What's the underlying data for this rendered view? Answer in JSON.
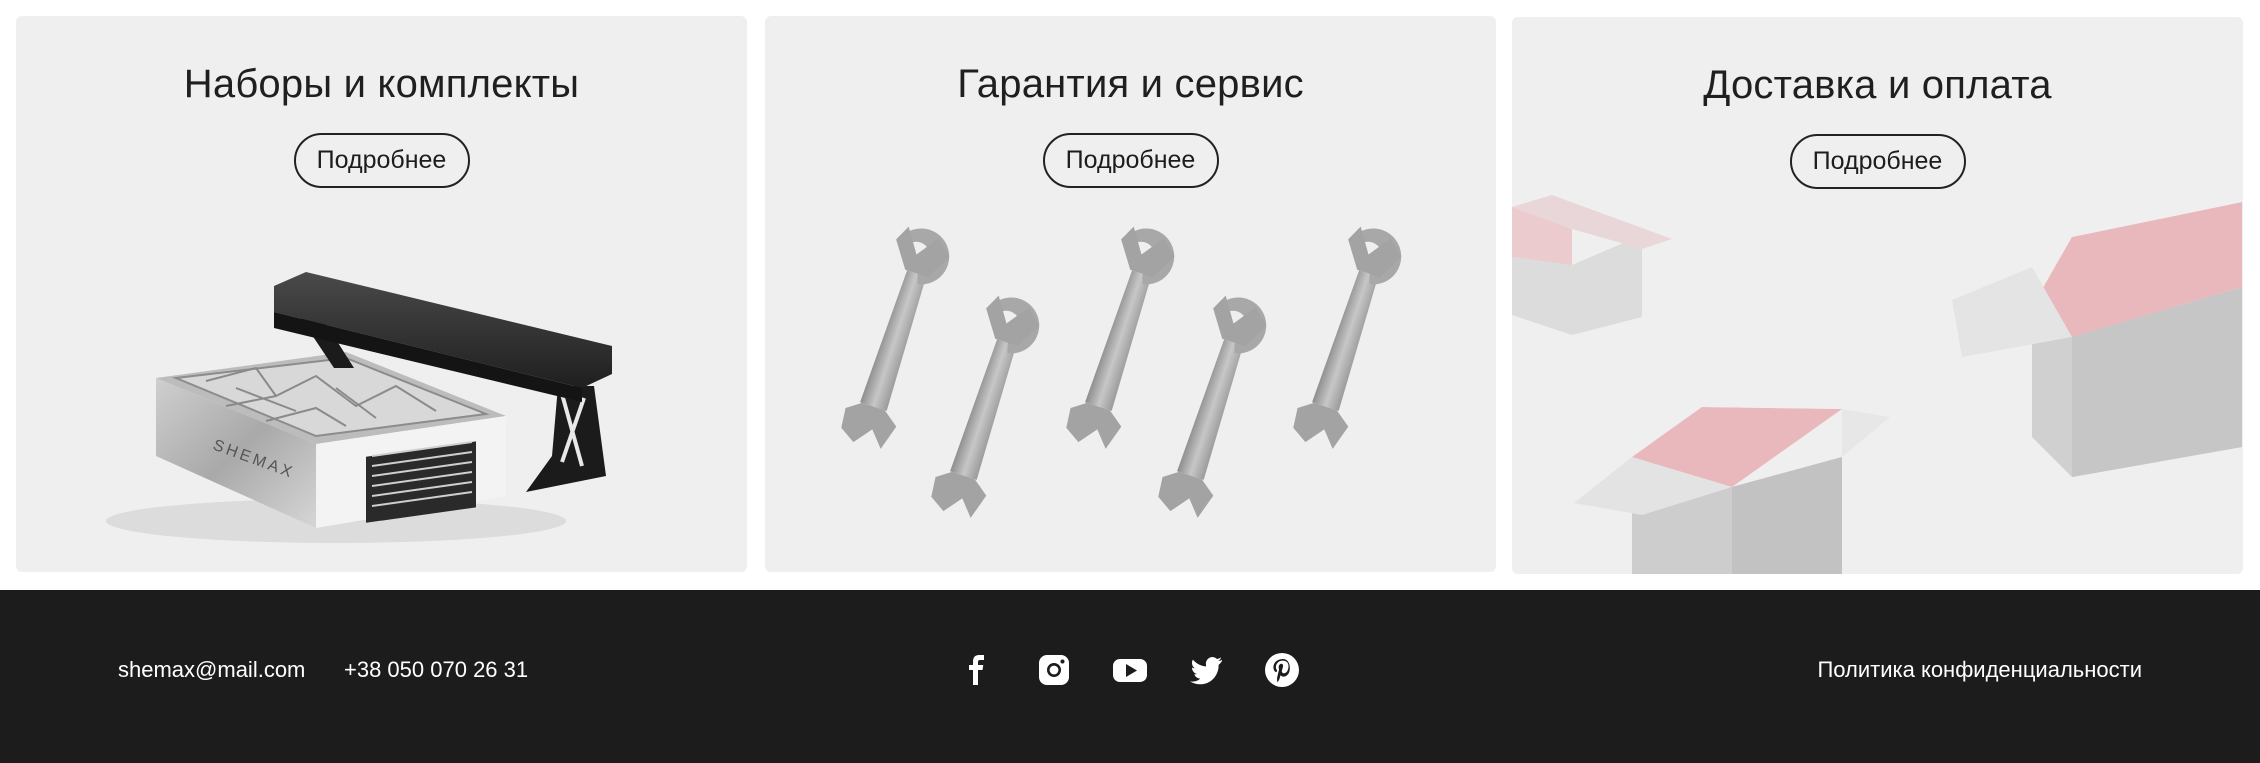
{
  "cards": [
    {
      "title": "Наборы и комплекты",
      "button_label": "Подробнее",
      "art": "nail-dust-collector-with-armrest"
    },
    {
      "title": "Гарантия и сервис",
      "button_label": "Подробнее",
      "art": "wrenches"
    },
    {
      "title": "Доставка и оплата",
      "button_label": "Подробнее",
      "art": "open-boxes"
    }
  ],
  "product_brand_text": "SHEMAX",
  "footer": {
    "email": "shemax@mail.com",
    "phone": "+38 050 070 26 31",
    "policy_link": "Политика конфиденциальности",
    "social": [
      "facebook-icon",
      "instagram-icon",
      "youtube-icon",
      "twitter-icon",
      "pinterest-icon"
    ]
  },
  "colors": {
    "card_background": "#efefef",
    "footer_background": "#1c1c1c",
    "box_inner_tint": "#e9b8bd"
  }
}
